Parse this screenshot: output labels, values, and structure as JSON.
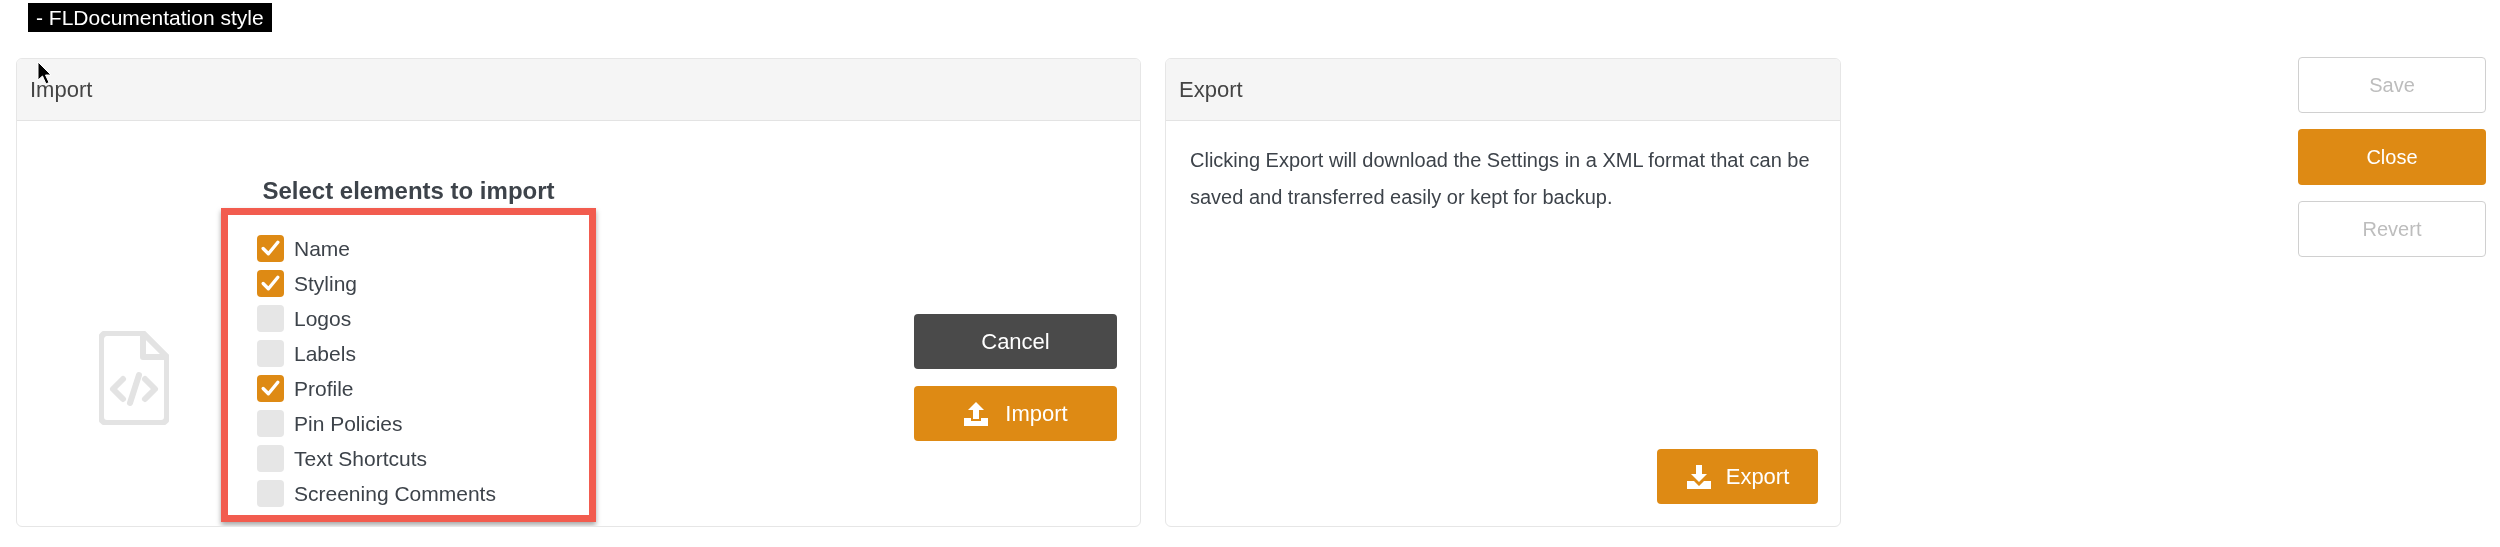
{
  "label": "- FLDocumentation style",
  "import": {
    "title": "Import",
    "heading": "Select elements to import",
    "items": [
      {
        "label": "Name",
        "checked": true
      },
      {
        "label": "Styling",
        "checked": true
      },
      {
        "label": "Logos",
        "checked": false
      },
      {
        "label": "Labels",
        "checked": false
      },
      {
        "label": "Profile",
        "checked": true
      },
      {
        "label": "Pin Policies",
        "checked": false
      },
      {
        "label": "Text Shortcuts",
        "checked": false
      },
      {
        "label": "Screening Comments",
        "checked": false
      }
    ],
    "buttons": [
      {
        "label": "Cancel",
        "kind": "secondary"
      },
      {
        "label": "Import",
        "kind": "primary"
      }
    ]
  },
  "export": {
    "title": "Export",
    "text": "Clicking Export will download the Settings in a XML format that can be saved and transferred easily or kept for backup.",
    "button": {
      "label": "Export"
    }
  },
  "actions": [
    {
      "label": "Save",
      "disabled": true
    },
    {
      "label": "Close",
      "disabled": false
    },
    {
      "label": "Revert",
      "disabled": true
    }
  ]
}
